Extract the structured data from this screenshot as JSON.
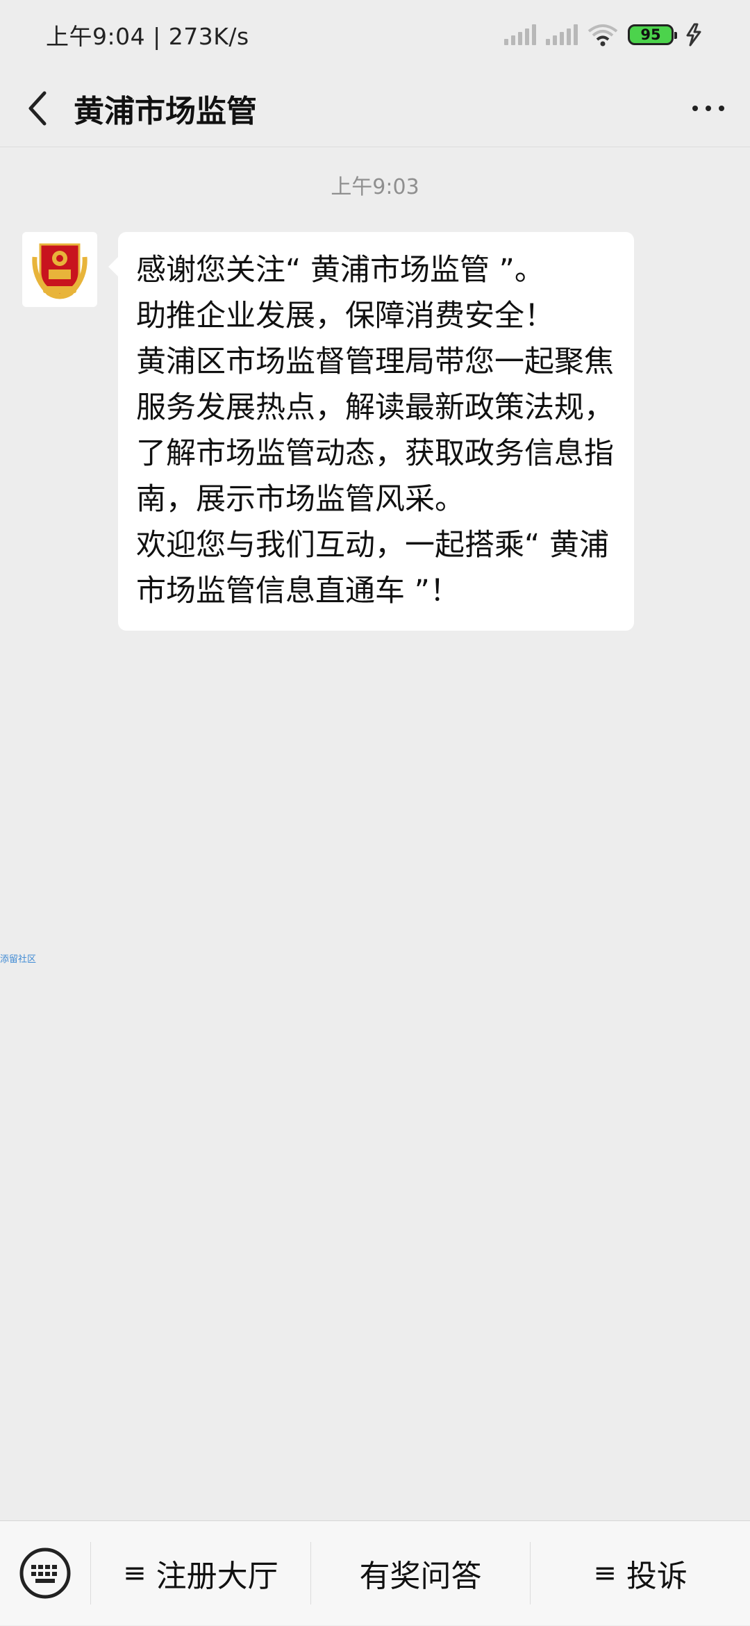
{
  "status_bar": {
    "time_speed": "上午9:04 | 273K/s",
    "battery_level": "95",
    "icons": [
      "signal-icon",
      "signal-icon",
      "wifi-icon",
      "battery-icon",
      "charging-icon"
    ]
  },
  "nav": {
    "title": "黄浦市场监管",
    "back_icon": "chevron-left-icon",
    "more_icon": "more-dots-icon"
  },
  "chat": {
    "timestamp": "上午9:03",
    "message": "感谢您关注“ 黄浦市场监管 ”。\n助推企业发展，保障消费安全！\n黄浦区市场监督管理局带您一起聚焦服务发展热点，解读最新政策法规，了解市场监管动态，获取政务信息指南，展示市场监管风采。\n欢迎您与我们互动，一起搭乘“ 黄浦市场监管信息直通车 ”！",
    "side_link": "添留社区"
  },
  "bottom_menu": {
    "keyboard_icon": "keyboard-icon",
    "items": [
      {
        "label": "注册大厅",
        "has_menu": true
      },
      {
        "label": "有奖问答",
        "has_menu": false
      },
      {
        "label": "投诉",
        "has_menu": true
      }
    ],
    "menu_icon_glyph": "≡"
  },
  "colors": {
    "background": "#ededed",
    "bubble": "#ffffff",
    "bottom_bar": "#f7f7f7",
    "battery": "#4cd34c",
    "emblem_red": "#c8141e",
    "emblem_gold": "#e8b43a"
  }
}
